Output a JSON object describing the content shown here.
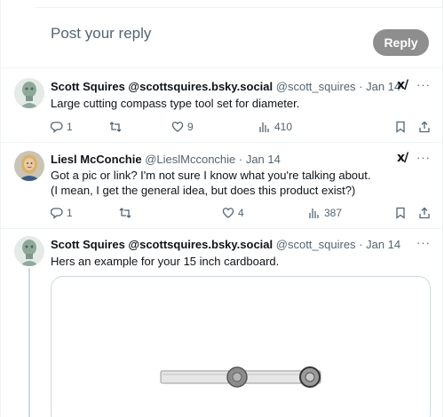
{
  "reply_box": {
    "placeholder": "Post your reply",
    "button_label": "Reply"
  },
  "tweets": [
    {
      "name": "Scott Squires @scottsquires.bsky.social",
      "meta": "@scott_squires · Jan 14",
      "lines": [
        "Large cutting compass type tool set for diameter."
      ],
      "replies": "1",
      "reposts": "",
      "likes": "9",
      "views": "410"
    },
    {
      "name": "Liesl McConchie",
      "meta": "@LieslMcconchie · Jan 14",
      "lines": [
        "Got a pic or link? I'm not sure I know what you're talking about.",
        "(I mean, I get the general idea, but does this product exist?)"
      ],
      "replies": "1",
      "reposts": "",
      "likes": "4",
      "views": "387"
    },
    {
      "name": "Scott Squires @scottsquires.bsky.social",
      "meta": "@scott_squires · Jan 14",
      "lines": [
        "Hers an example for your 15 inch cardboard."
      ]
    }
  ],
  "icons": {
    "grok": "grok-icon",
    "more": "more-icon",
    "reply": "reply-icon",
    "repost": "repost-icon",
    "like": "like-icon",
    "views": "views-icon",
    "bookmark": "bookmark-icon",
    "share": "share-icon"
  },
  "colors": {
    "reply_button": "#8e8e8e",
    "secondary_text": "#536471",
    "border": "#eff3f4"
  }
}
